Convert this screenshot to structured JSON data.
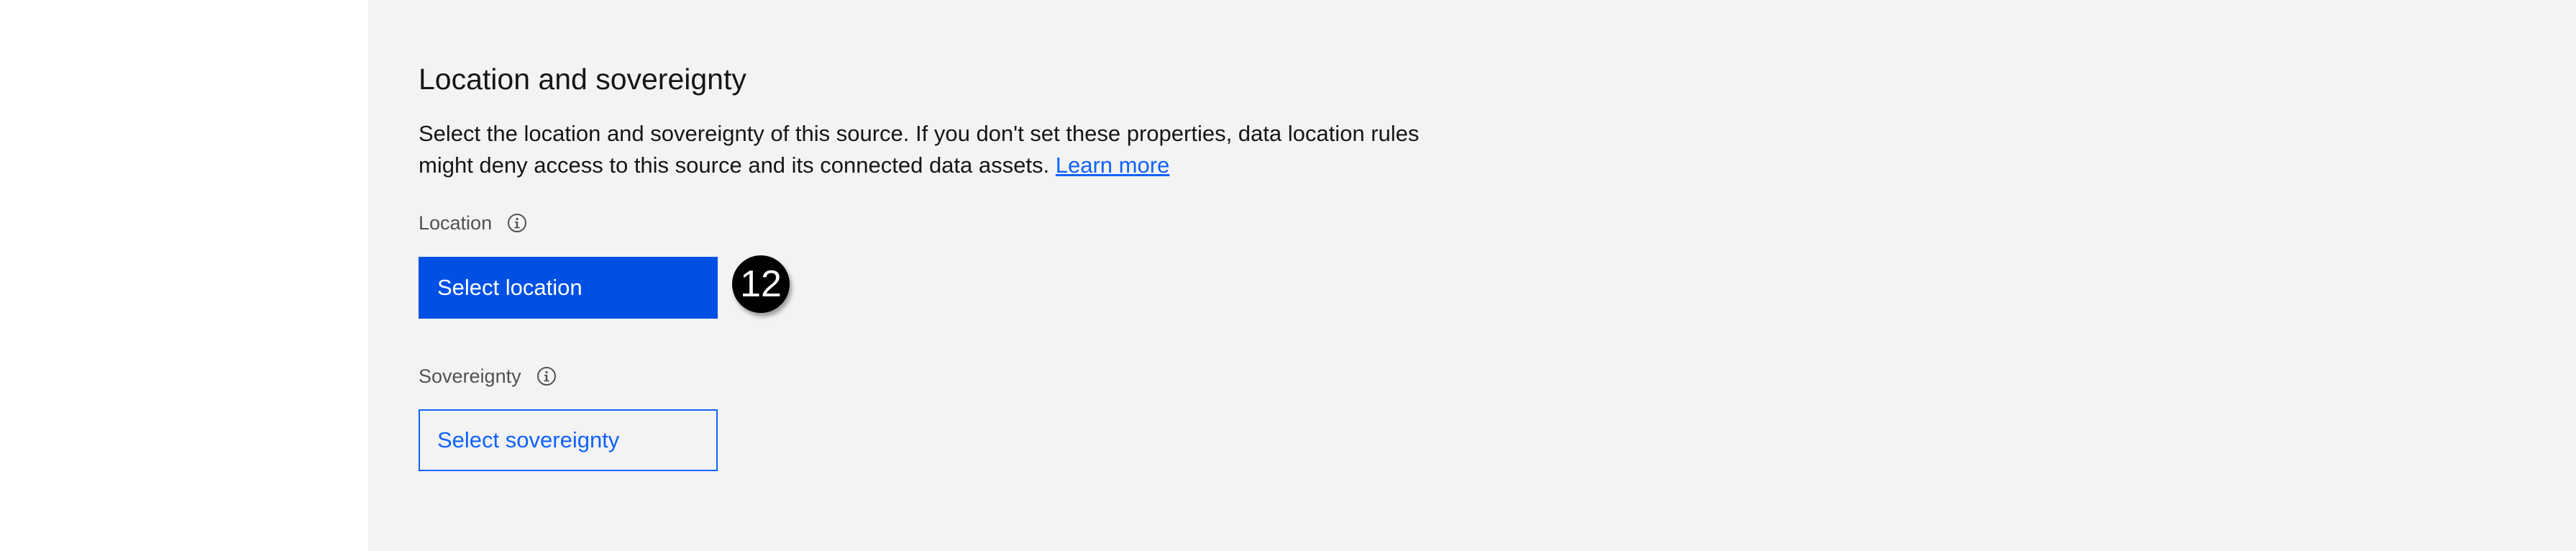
{
  "section": {
    "title": "Location and sovereignty",
    "description": "Select the location and sovereignty of this source. If you don't set these properties, data location rules might deny access to this source and its connected data assets.",
    "learn_more": "Learn more"
  },
  "location": {
    "label": "Location",
    "button_label": "Select location"
  },
  "sovereignty": {
    "label": "Sovereignty",
    "button_label": "Select sovereignty"
  },
  "annotation": {
    "step_number": "12"
  },
  "icons": {
    "info": "info-icon"
  },
  "colors": {
    "primary": "#0050e6",
    "link": "#0f62fe",
    "panel_bg": "#f3f3f3",
    "text": "#161616",
    "label": "#525252"
  }
}
